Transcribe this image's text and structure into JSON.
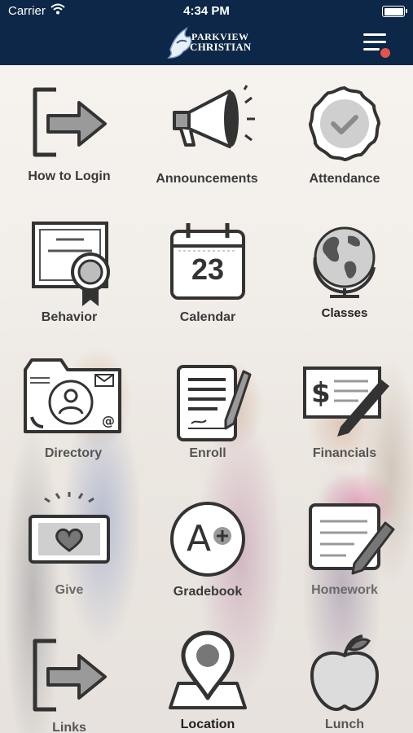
{
  "status_bar": {
    "carrier": "Carrier",
    "time": "4:34 PM"
  },
  "header": {
    "logo_line1": "PARKVIEW",
    "logo_line2": "CHRISTIAN",
    "logo_icon": "eagle-logo-icon",
    "menu_icon": "hamburger-menu-icon",
    "notification_dot_color": "#e5534b",
    "bar_color": "#0d2748"
  },
  "tiles": [
    {
      "label": "How to Login",
      "icon": "login-arrow-icon"
    },
    {
      "label": "Announcements",
      "icon": "megaphone-icon"
    },
    {
      "label": "Attendance",
      "icon": "badge-check-icon"
    },
    {
      "label": "Behavior",
      "icon": "certificate-icon"
    },
    {
      "label": "Calendar",
      "icon": "calendar-icon",
      "calendar_day": "23"
    },
    {
      "label": "Classes",
      "icon": "globe-icon"
    },
    {
      "label": "Directory",
      "icon": "contact-card-icon"
    },
    {
      "label": "Enroll",
      "icon": "document-pen-icon"
    },
    {
      "label": "Financials",
      "icon": "check-pen-icon"
    },
    {
      "label": "Give",
      "icon": "heart-bill-icon"
    },
    {
      "label": "Gradebook",
      "icon": "a-plus-grade-icon",
      "grade_letter": "A"
    },
    {
      "label": "Homework",
      "icon": "notepad-pencil-icon"
    },
    {
      "label": "Links",
      "icon": "link-arrow-icon"
    },
    {
      "label": "Location",
      "icon": "map-pin-icon"
    },
    {
      "label": "Lunch",
      "icon": "apple-icon"
    }
  ]
}
